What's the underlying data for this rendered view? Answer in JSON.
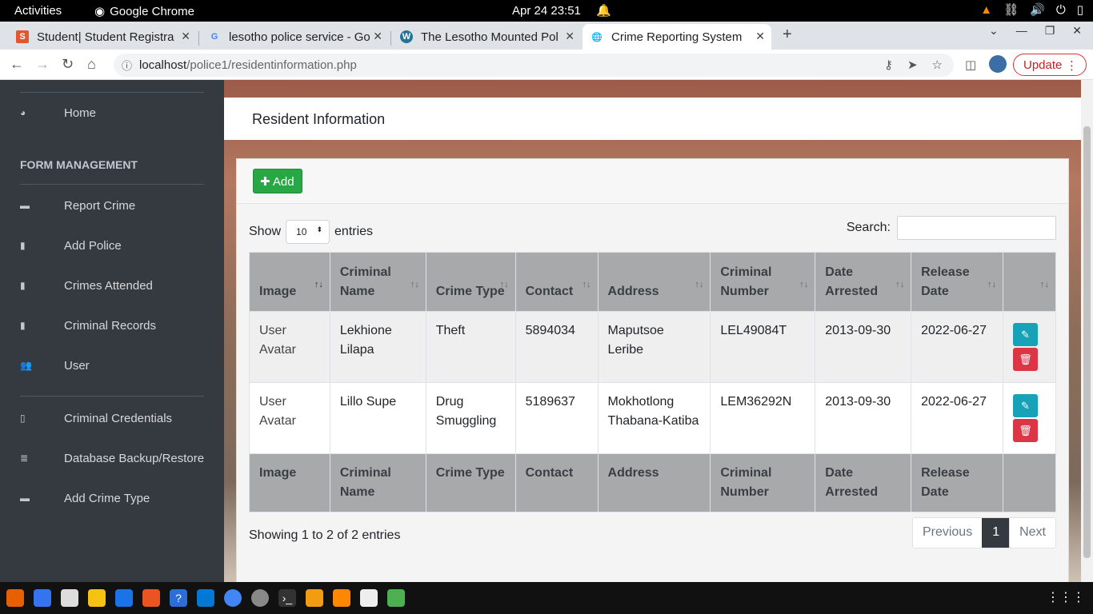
{
  "system": {
    "activities": "Activities",
    "app_name": "Google Chrome",
    "clock": "Apr 24  23:51"
  },
  "tabs": [
    {
      "title": "Student| Student Registra",
      "icon": "s-favicon"
    },
    {
      "title": "lesotho police service - Go",
      "icon": "google-favicon"
    },
    {
      "title": "The Lesotho Mounted Pol",
      "icon": "wordpress-favicon"
    },
    {
      "title": "Crime Reporting System",
      "icon": "globe-favicon"
    }
  ],
  "url": {
    "host": "localhost",
    "path": "/police1/residentinformation.php"
  },
  "update_label": "Update",
  "sidebar": {
    "items_top": [
      {
        "label": "Home",
        "icon": "dashboard-icon"
      }
    ],
    "section": "FORM MANAGEMENT",
    "items": [
      {
        "label": "Report Crime",
        "icon": "folder-icon"
      },
      {
        "label": "Add Police",
        "icon": "file-icon"
      },
      {
        "label": "Crimes Attended",
        "icon": "file-icon"
      },
      {
        "label": "Criminal Records",
        "icon": "file-icon"
      },
      {
        "label": "User",
        "icon": "users-icon"
      }
    ],
    "items_bottom": [
      {
        "label": "Criminal Credentials",
        "icon": "file-outline-icon"
      },
      {
        "label": "Database Backup/Restore",
        "icon": "database-icon"
      },
      {
        "label": "Add Crime Type",
        "icon": "folder-icon"
      }
    ]
  },
  "page": {
    "title": "Resident Information",
    "add_label": "Add"
  },
  "table_controls": {
    "show": "Show",
    "entries_value": "10",
    "entries": "entries",
    "search": "Search:"
  },
  "table": {
    "headers": [
      "Image",
      "Criminal Name",
      "Crime Type",
      "Contact",
      "Address",
      "Criminal Number",
      "Date Arrested",
      "Release Date"
    ],
    "footer_headers": [
      "Image",
      "Criminal Name",
      "Crime Type",
      "Contact",
      "Address",
      "Criminal Number",
      "Date Arrested",
      "Release Date"
    ],
    "rows": [
      {
        "image": "User Avatar",
        "name": "Lekhione Lilapa",
        "crime": "Theft",
        "contact": "5894034",
        "address": "Maputsoe Leribe",
        "number": "LEL49084T",
        "arrested": "2013-09-30",
        "release": "2022-06-27"
      },
      {
        "image": "User Avatar",
        "name": "Lillo Supe",
        "crime": "Drug Smuggling",
        "contact": "5189637",
        "address": "Mokhotlong Thabana-Katiba",
        "number": "LEM36292N",
        "arrested": "2013-09-30",
        "release": "2022-06-27"
      }
    ]
  },
  "footer": {
    "info": "Showing 1 to 2 of 2 entries",
    "prev": "Previous",
    "page": "1",
    "next": "Next"
  },
  "colors": {
    "sidebar": "#343a40",
    "add_button": "#28a745",
    "edit_button": "#17a2b8",
    "delete_button": "#dc3545",
    "table_header": "#a7a9ab"
  }
}
